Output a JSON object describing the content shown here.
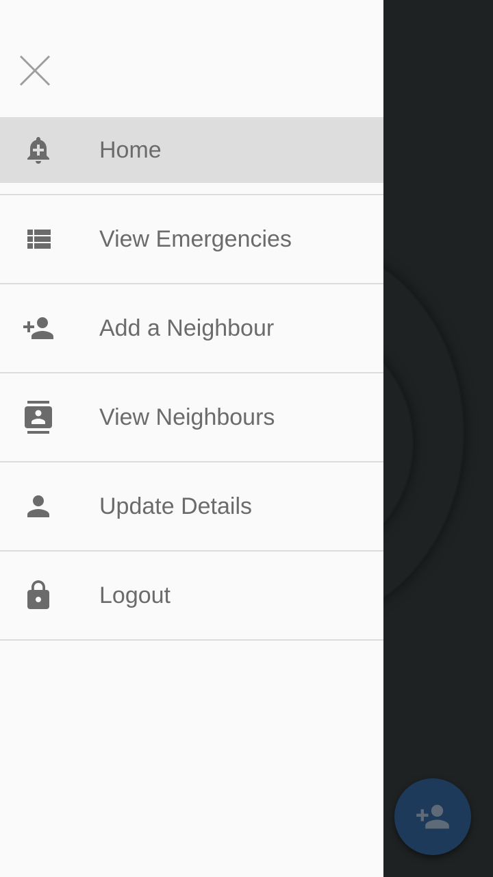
{
  "drawer": {
    "menu_items": [
      {
        "label": "Home",
        "icon": "bell-plus-icon",
        "active": true
      },
      {
        "label": "View Emergencies",
        "icon": "list-icon",
        "active": false
      },
      {
        "label": "Add a Neighbour",
        "icon": "person-add-icon",
        "active": false
      },
      {
        "label": "View Neighbours",
        "icon": "contacts-icon",
        "active": false
      },
      {
        "label": "Update Details",
        "icon": "person-icon",
        "active": false
      },
      {
        "label": "Logout",
        "icon": "lock-icon",
        "active": false
      }
    ]
  },
  "background": {
    "fab_icon": "person-add-icon"
  },
  "colors": {
    "drawer_bg": "#fafafa",
    "active_item_bg": "#dddddd",
    "icon_color": "#6b6b6b",
    "fab_bg": "#1d3a5a",
    "scrim_bg": "#1f2223"
  }
}
